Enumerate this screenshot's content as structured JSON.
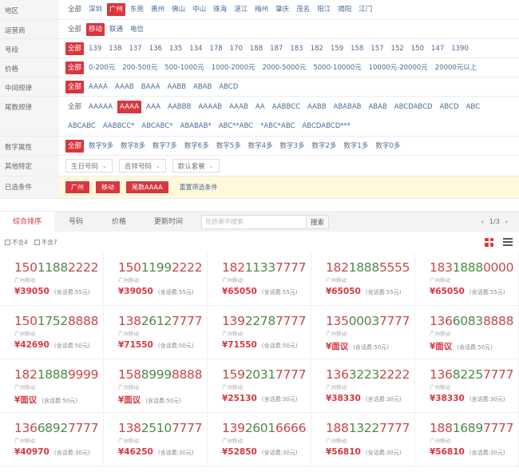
{
  "filters": {
    "region": {
      "label": "地区",
      "options": [
        "全部",
        "深圳",
        "广州",
        "东莞",
        "惠州",
        "佛山",
        "中山",
        "珠海",
        "湛江",
        "梅州",
        "肇庆",
        "茂名",
        "阳江",
        "揭阳",
        "江门"
      ],
      "active_index": 2
    },
    "carrier": {
      "label": "运营商",
      "options": [
        "全部",
        "移动",
        "联通",
        "电信"
      ],
      "active_index": 1
    },
    "prefix": {
      "label": "号段",
      "options": [
        "全部",
        "139",
        "138",
        "137",
        "136",
        "135",
        "134",
        "178",
        "170",
        "188",
        "187",
        "183",
        "182",
        "159",
        "158",
        "157",
        "152",
        "150",
        "147",
        "1390"
      ],
      "active_index": 0
    },
    "price": {
      "label": "价格",
      "options": [
        "全部",
        "0-200元",
        "200-500元",
        "500-1000元",
        "1000-2000元",
        "2000-5000元",
        "5000-10000元",
        "10000元-20000元",
        "20000元以上"
      ],
      "active_index": 0
    },
    "middle_pattern": {
      "label": "中间规律",
      "options": [
        "全部",
        "AAAA",
        "AAAB",
        "BAAA",
        "AABB",
        "ABAB",
        "ABCD"
      ],
      "active_index": 0
    },
    "tail_pattern": {
      "label": "尾数规律",
      "options": [
        "全部",
        "AAAAA",
        "AAAA",
        "AAA",
        "AABBB",
        "AAAAB",
        "AAAB",
        "AA",
        "AABBCC",
        "AABB",
        "ABABAB",
        "ABAB",
        "ABCDABCD",
        "ABCD",
        "ABC",
        "ABCABC",
        "AABBCC*",
        "ABCABC*",
        "ABABAB*",
        "ABC**ABC",
        "*ABC*ABC",
        "ABCDABCD***"
      ],
      "active_index": 2
    },
    "digit_attr": {
      "label": "数字属性",
      "options": [
        "全部",
        "数字9多",
        "数字8多",
        "数字7多",
        "数字6多",
        "数字5多",
        "数字4多",
        "数字3多",
        "数字2多",
        "数字1多",
        "数字0多"
      ],
      "active_index": 0
    },
    "other": {
      "label": "其他特定",
      "dropdowns": [
        "生日号码",
        "吉祥号码",
        "默认套餐"
      ]
    },
    "selected": {
      "label": "已选条件",
      "tags": [
        "广州",
        "移动",
        "尾数AAAA"
      ],
      "clear_label": "重置筛选条件"
    }
  },
  "sortbar": {
    "tabs": [
      "综合排序",
      "号码",
      "价格",
      "更新时间"
    ],
    "active_index": 0,
    "search_placeholder": "在结果中搜索",
    "search_button": "搜索",
    "pager_prev": "‹",
    "pager_text": "1/3",
    "pager_next": "›"
  },
  "options_bar": {
    "checkboxes": [
      "不含4",
      "不含7"
    ],
    "view_grid": "grid-view",
    "view_list": "list-view"
  },
  "colors": {
    "accent": "#d9363e",
    "number_red": "#c8464e",
    "number_green": "#4e8a45",
    "selected_bg": "#fff8dc"
  },
  "listings": [
    {
      "number": "15011882222",
      "location": "广州移动",
      "price": "¥39050",
      "fee": "(含话费:55元)"
    },
    {
      "number": "15011992222",
      "location": "广州移动",
      "price": "¥39050",
      "fee": "(含话费:55元)"
    },
    {
      "number": "18211337777",
      "location": "广州移动",
      "price": "¥65050",
      "fee": "(含话费:55元)"
    },
    {
      "number": "18218885555",
      "location": "广州移动",
      "price": "¥65050",
      "fee": "(含话费:55元)"
    },
    {
      "number": "18318880000",
      "location": "广州移动",
      "price": "¥65050",
      "fee": "(含话费:55元)"
    },
    {
      "number": "15017528888",
      "location": "广州移动",
      "price": "¥42690",
      "fee": "(含话费:50元)"
    },
    {
      "number": "13826127777",
      "location": "广州移动",
      "price": "¥71550",
      "fee": "(含话费:50元)"
    },
    {
      "number": "13922787777",
      "location": "广州移动",
      "price": "¥71550",
      "fee": "(含话费:50元)"
    },
    {
      "number": "13500037777",
      "location": "广州移动",
      "price": "¥面议",
      "fee": "(含话费:50元)"
    },
    {
      "number": "13660838888",
      "location": "广州移动",
      "price": "¥面议",
      "fee": "(含话费:50元)"
    },
    {
      "number": "18218889999",
      "location": "广州移动",
      "price": "¥面议",
      "fee": "(含话费:50元)"
    },
    {
      "number": "15889998888",
      "location": "广州移动",
      "price": "¥面议",
      "fee": "(含话费:50元)"
    },
    {
      "number": "15920317777",
      "location": "广州移动",
      "price": "¥25130",
      "fee": "(含话费:30元)"
    },
    {
      "number": "13632232222",
      "location": "广州移动",
      "price": "¥38330",
      "fee": "(含话费:30元)"
    },
    {
      "number": "13682257777",
      "location": "广州移动",
      "price": "¥38330",
      "fee": "(含话费:30元)"
    },
    {
      "number": "13668927777",
      "location": "广州移动",
      "price": "¥40970",
      "fee": "(含话费:30元)"
    },
    {
      "number": "13825107777",
      "location": "广州移动",
      "price": "¥46250",
      "fee": "(含话费:30元)"
    },
    {
      "number": "13926016666",
      "location": "广州移动",
      "price": "¥52850",
      "fee": "(含话费:30元)"
    },
    {
      "number": "18813227777",
      "location": "广州移动",
      "price": "¥56810",
      "fee": "(含话费:30元)"
    },
    {
      "number": "18816897777",
      "location": "广州移动",
      "price": "¥56810",
      "fee": "(含话费:30元)"
    }
  ]
}
